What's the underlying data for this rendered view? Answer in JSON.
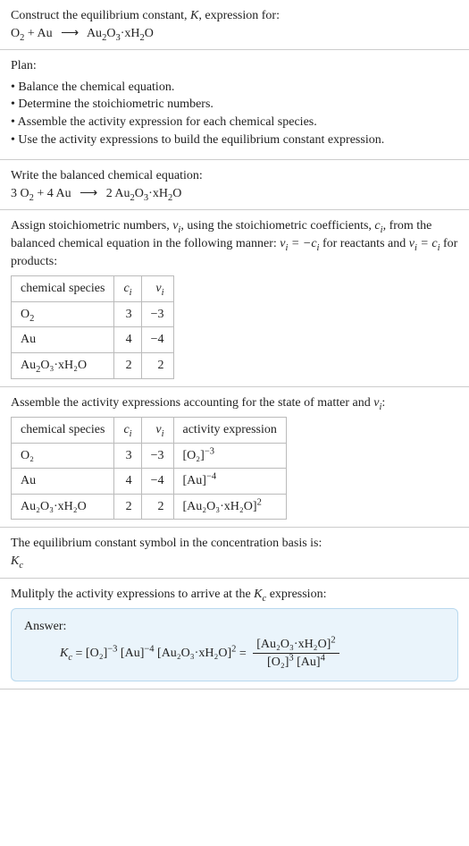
{
  "s1": {
    "title_a": "Construct the equilibrium constant, ",
    "title_b": ", expression for:",
    "lhs1": "O",
    "lhs1_sub": "2",
    "plus": " + ",
    "lhs2": "Au",
    "arrow": "⟶",
    "rhs1": "Au",
    "rhs1_sub1": "2",
    "rhs1_mid": "O",
    "rhs1_sub2": "3",
    "rhs1_tail": "·xH",
    "rhs1_sub3": "2",
    "rhs1_end": "O"
  },
  "s2": {
    "title": "Plan:",
    "items": [
      "Balance the chemical equation.",
      "Determine the stoichiometric numbers.",
      "Assemble the activity expression for each chemical species.",
      "Use the activity expressions to build the equilibrium constant expression."
    ]
  },
  "s3": {
    "title": "Write the balanced chemical equation:",
    "c1": "3 O",
    "c1_sub": "2",
    "plus": " + ",
    "c2": "4 Au",
    "arrow": "⟶",
    "c3": "2 Au",
    "c3_sub1": "2",
    "c3_mid": "O",
    "c3_sub2": "3",
    "c3_tail": "·xH",
    "c3_sub3": "2",
    "c3_end": "O"
  },
  "s4": {
    "p1": "Assign stoichiometric numbers, ",
    "p2": ", using the stoichiometric coefficients, ",
    "p3": ", from the balanced chemical equation in the following manner: ",
    "p4": " for reactants and ",
    "p5": " for products:",
    "nu": "ν",
    "ci": "c",
    "sub_i": "i",
    "eq1a": "ν",
    "eq1b": " = −c",
    "eq2a": "ν",
    "eq2b": " = c",
    "headers": {
      "h1": "chemical species",
      "h2": "c",
      "h3": "ν"
    },
    "rows": [
      {
        "sp_a": "O",
        "sp_sub": "2",
        "sp_b": "",
        "c": "3",
        "v": "−3"
      },
      {
        "sp_a": "Au",
        "sp_sub": "",
        "sp_b": "",
        "c": "4",
        "v": "−4"
      },
      {
        "sp_a": "Au",
        "sp_sub": "2",
        "sp_b": "O₃·xH₂O",
        "c": "2",
        "v": "2"
      }
    ]
  },
  "s5": {
    "p1": "Assemble the activity expressions accounting for the state of matter and ",
    "p2": ":",
    "headers": {
      "h1": "chemical species",
      "h2": "c",
      "h3": "ν",
      "h4": "activity expression"
    },
    "rows": [
      {
        "sp": "O₂",
        "c": "3",
        "v": "−3",
        "act_base": "[O₂]",
        "act_exp": "−3"
      },
      {
        "sp": "Au",
        "c": "4",
        "v": "−4",
        "act_base": "[Au]",
        "act_exp": "−4"
      },
      {
        "sp": "Au₂O₃·xH₂O",
        "c": "2",
        "v": "2",
        "act_base": "[Au₂O₃·xH₂O]",
        "act_exp": "2"
      }
    ]
  },
  "s6": {
    "line1": "The equilibrium constant symbol in the concentration basis is:",
    "Kc_K": "K",
    "Kc_c": "c"
  },
  "s7": {
    "line1a": "Mulitply the activity expressions to arrive at the ",
    "line1b": " expression:",
    "answer_label": "Answer:",
    "lhs_K": "K",
    "lhs_c": "c",
    "eqs": " = ",
    "t1_base": "[O₂]",
    "t1_exp": "−3",
    "sp": " ",
    "t2_base": "[Au]",
    "t2_exp": "−4",
    "t3_base": "[Au₂O₃·xH₂O]",
    "t3_exp": "2",
    "frac_num_base": "[Au₂O₃·xH₂O]",
    "frac_num_exp": "2",
    "frac_den1_base": "[O₂]",
    "frac_den1_exp": "3",
    "frac_den2_base": "[Au]",
    "frac_den2_exp": "4"
  },
  "chart_data": {
    "type": "table",
    "tables": [
      {
        "title": "Stoichiometric numbers",
        "columns": [
          "chemical species",
          "c_i",
          "ν_i"
        ],
        "rows": [
          [
            "O2",
            3,
            -3
          ],
          [
            "Au",
            4,
            -4
          ],
          [
            "Au2O3·xH2O",
            2,
            2
          ]
        ]
      },
      {
        "title": "Activity expressions",
        "columns": [
          "chemical species",
          "c_i",
          "ν_i",
          "activity expression"
        ],
        "rows": [
          [
            "O2",
            3,
            -3,
            "[O2]^-3"
          ],
          [
            "Au",
            4,
            -4,
            "[Au]^-4"
          ],
          [
            "Au2O3·xH2O",
            2,
            2,
            "[Au2O3·xH2O]^2"
          ]
        ]
      }
    ]
  }
}
